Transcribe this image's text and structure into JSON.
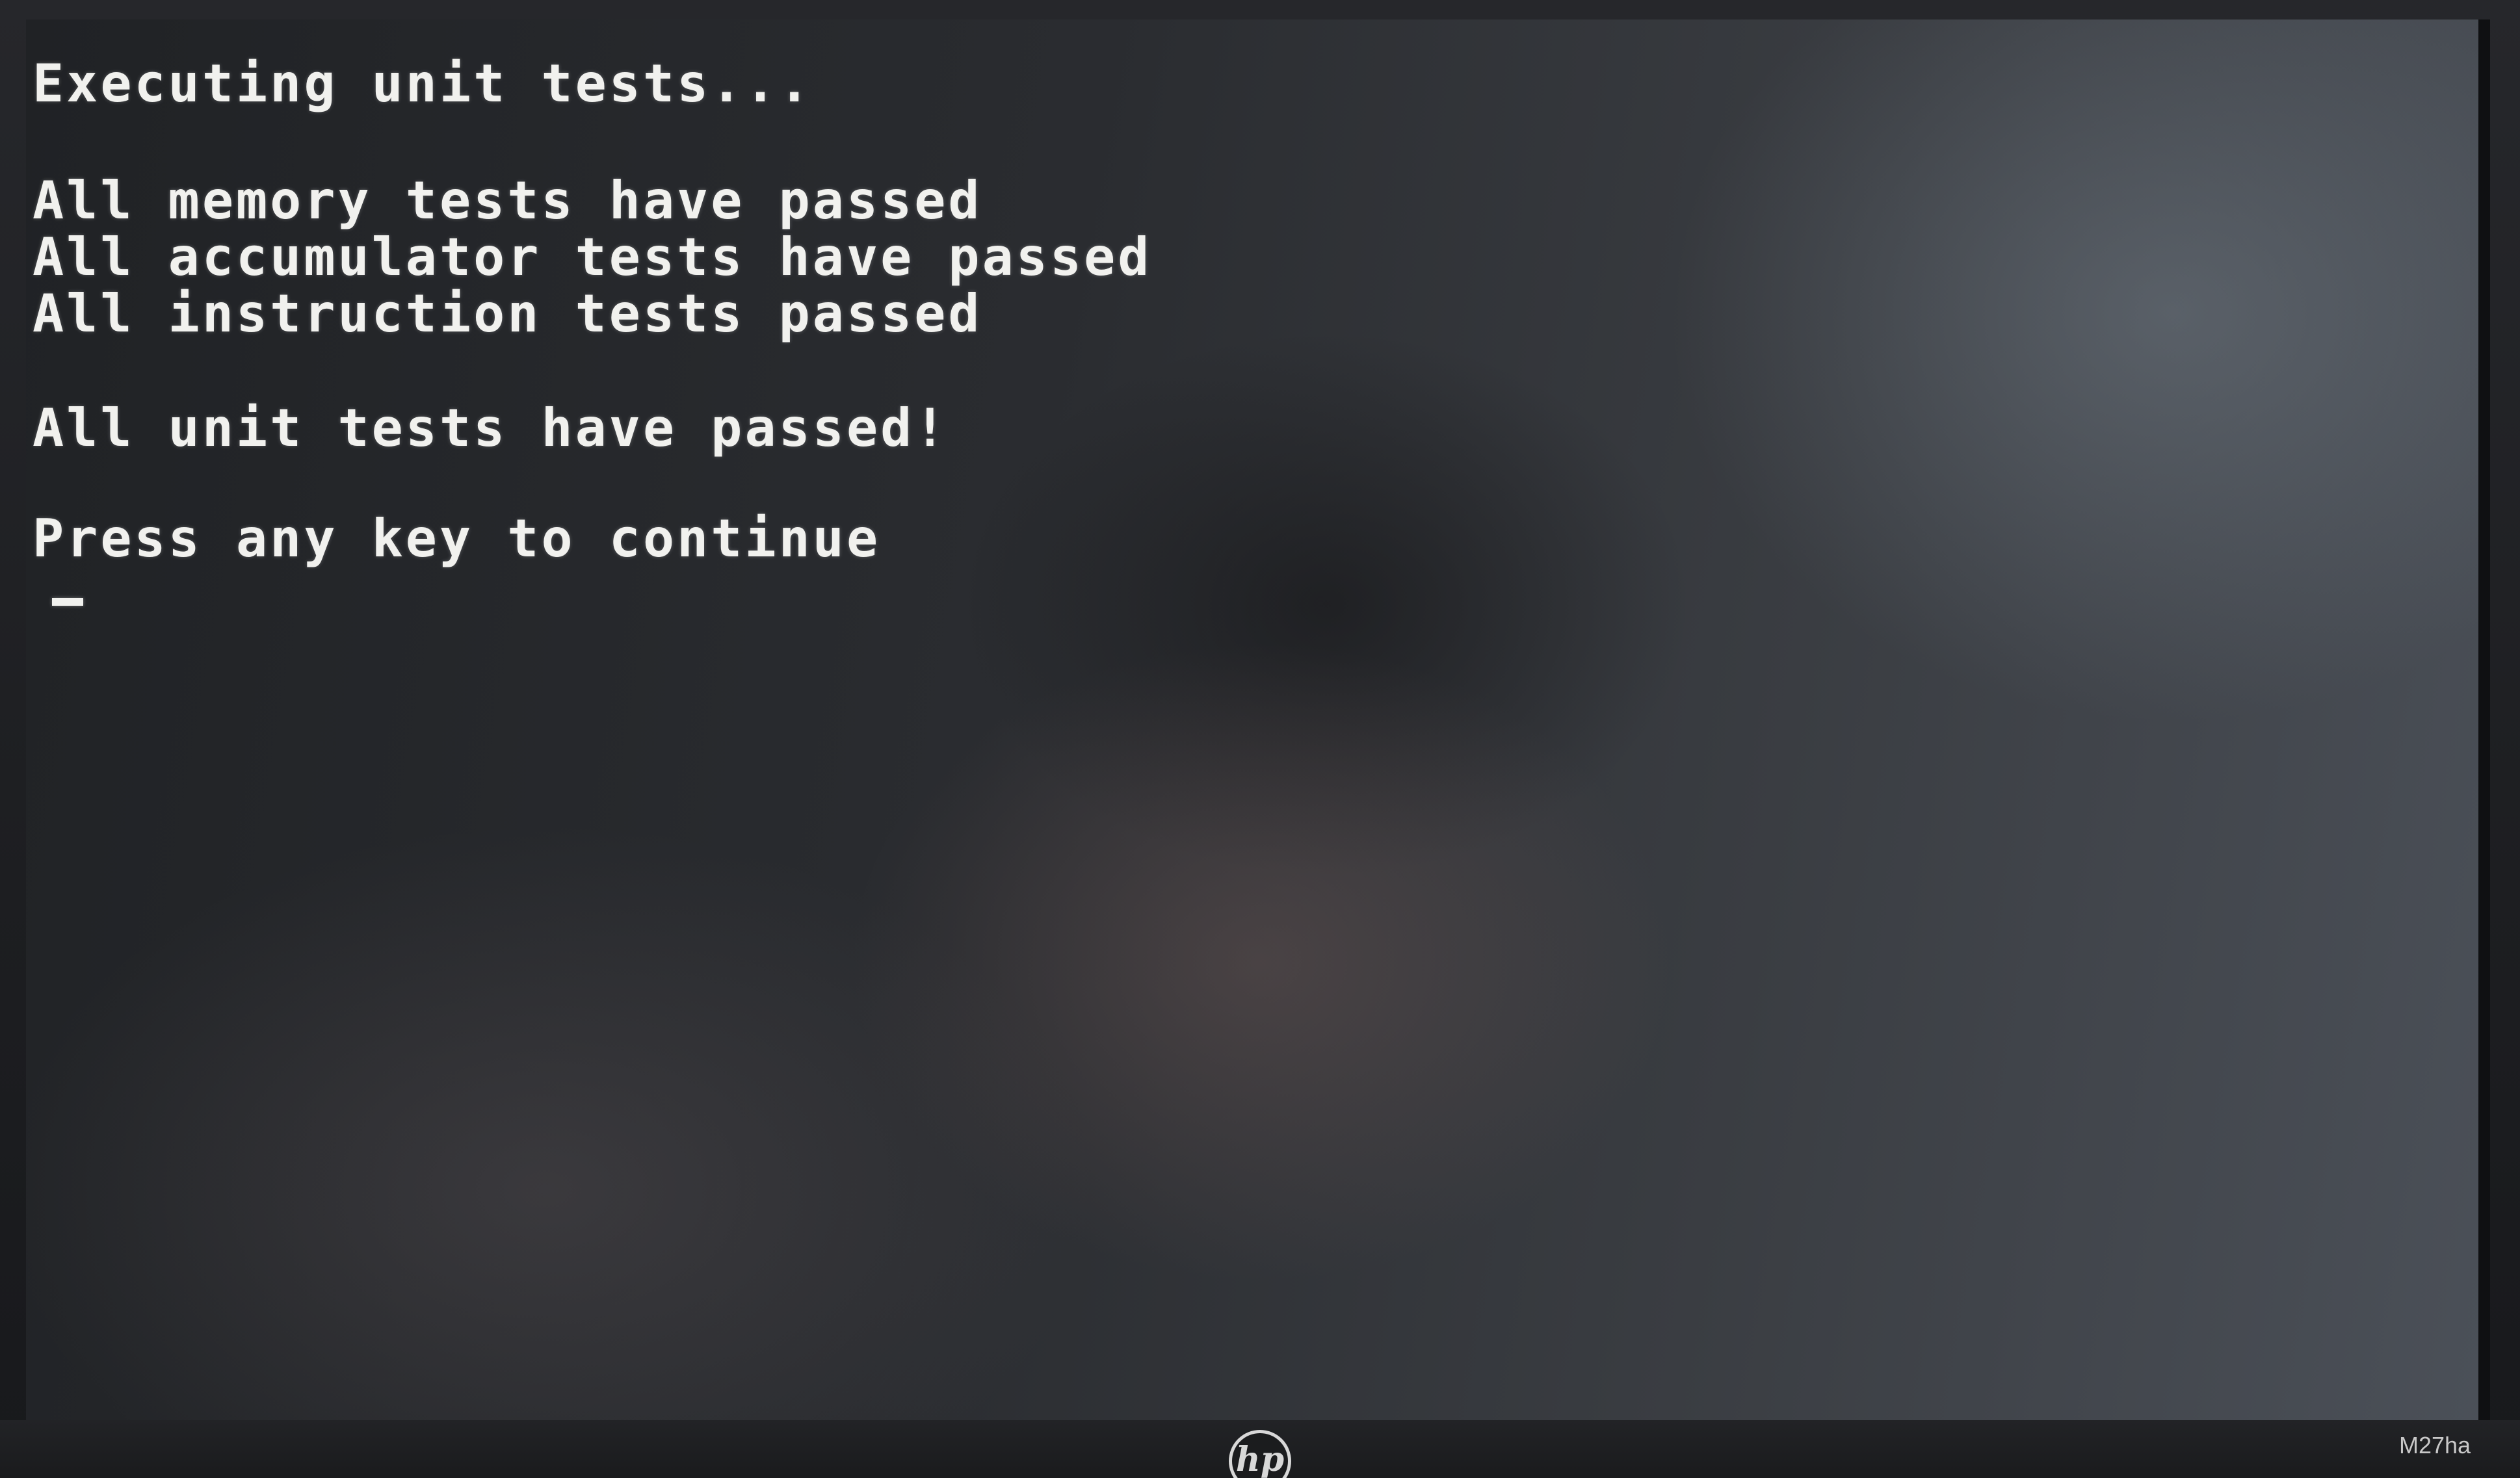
{
  "terminal": {
    "lines": [
      "Executing unit tests...",
      "All memory tests have passed",
      "All accumulator tests have passed",
      "All instruction tests passed",
      "All unit tests have passed!",
      "Press any key to continue"
    ],
    "cursor": "_"
  },
  "monitor": {
    "brand_logo": "hp",
    "model": "M27ha"
  }
}
